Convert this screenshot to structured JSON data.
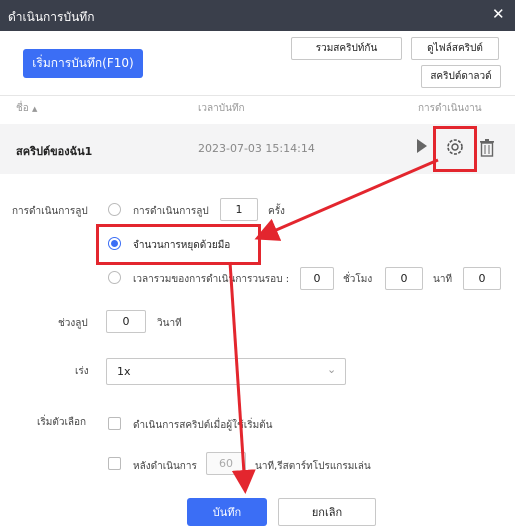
{
  "window": {
    "title": "ดำเนินการบันทึก"
  },
  "toolbar": {
    "record_button": "เริ่มการบันทึก(F10)",
    "merge_button": "รวมสคริปท์กัน",
    "view_file_button": "ดูไฟล์สคริปต์",
    "download_button": "สคริปต์ดาลวด์"
  },
  "table": {
    "columns": [
      "ชื่อ",
      "เวลาบันทึก",
      "การดำเนินงาน"
    ],
    "rows": [
      {
        "name": "สคริปต์ของฉัน1",
        "time": "2023-07-03 15:14:14"
      }
    ]
  },
  "settings": {
    "loop_label": "การดำเนินการลูป",
    "loop_count_label": "การดำเนินการลูป",
    "loop_count_value": "1",
    "loop_count_unit": "ครั้ง",
    "manual_stop_label": "จำนวนการหยุดด้วยมือ",
    "total_time_label": "เวลารวมของการดำเนินการวนรอบ :",
    "hours_value": "0",
    "hours_unit": "ชั่วโมง",
    "minutes_value": "0",
    "minutes_unit": "นาที",
    "seconds_value": "0",
    "interval_label": "ช่วงลูป",
    "interval_value": "0",
    "interval_unit": "วินาที",
    "speed_label": "เร่ง",
    "speed_value": "1x",
    "options_label": "เริ่มตัวเลือก",
    "option_start_label": "ดำเนินการสคริปต์เมื่อผู้ใช้เริ่มต้น",
    "option_after_label": "หลังดำเนินการ",
    "option_after_value": "60",
    "option_after_unit": "นาที,รีสตาร์ทโปรแกรมเล่น"
  },
  "footer": {
    "save_button": "บันทึก",
    "cancel_button": "ยกเลิก"
  }
}
